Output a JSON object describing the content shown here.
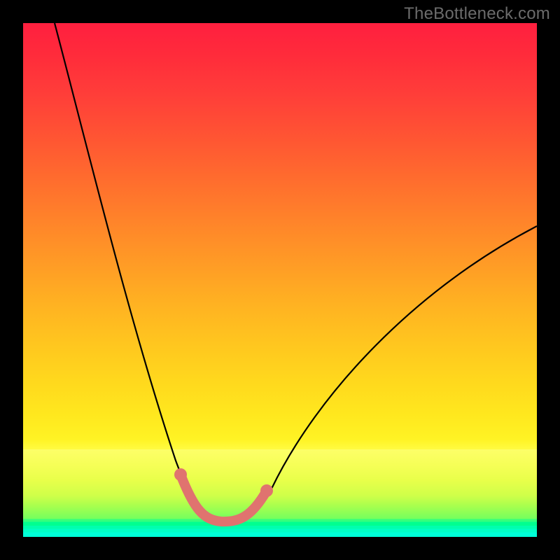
{
  "watermark": "TheBottleneck.com",
  "colors": {
    "frame_bg": "#000000",
    "curve": "#000000",
    "highlight": "#e0736f",
    "watermark": "#6b6b6b",
    "gradient_top": "#ff1f3f",
    "gradient_mid": "#fff324",
    "gradient_bottom": "#00ffd8"
  },
  "chart_data": {
    "type": "line",
    "title": "",
    "xlabel": "",
    "ylabel": "",
    "xlim": [
      0,
      100
    ],
    "ylim": [
      0,
      100
    ],
    "grid": false,
    "legend": false,
    "series": [
      {
        "name": "bottleneck-curve",
        "x": [
          6,
          10,
          15,
          20,
          25,
          30,
          33,
          36,
          38,
          40,
          43,
          47,
          55,
          65,
          80,
          100
        ],
        "y": [
          100,
          86,
          70,
          55,
          38,
          20,
          10,
          4,
          3,
          3,
          6,
          12,
          30,
          45,
          55,
          61
        ],
        "note": "Percent bottleneck vs relative GPU-to-CPU performance. Values read off the curve; y is bottleneck % where 0 is ideal (bottom) and 100 is worst (top)."
      }
    ],
    "highlight_range": {
      "name": "no-bottleneck-zone",
      "x_start": 31,
      "x_end": 47,
      "note": "Salmon-highlighted portion of the curve indicating the balanced (no-bottleneck) region near the minimum."
    },
    "background": {
      "type": "vertical-gradient",
      "meaning": "Red (top) = severe bottleneck, Green (bottom) = no bottleneck",
      "stops": [
        {
          "pos": 0.0,
          "color": "#ff1f3f"
        },
        {
          "pos": 0.5,
          "color": "#ffb022"
        },
        {
          "pos": 0.82,
          "color": "#fff324"
        },
        {
          "pos": 0.95,
          "color": "#74ff5e"
        },
        {
          "pos": 1.0,
          "color": "#00ffd8"
        }
      ]
    }
  }
}
